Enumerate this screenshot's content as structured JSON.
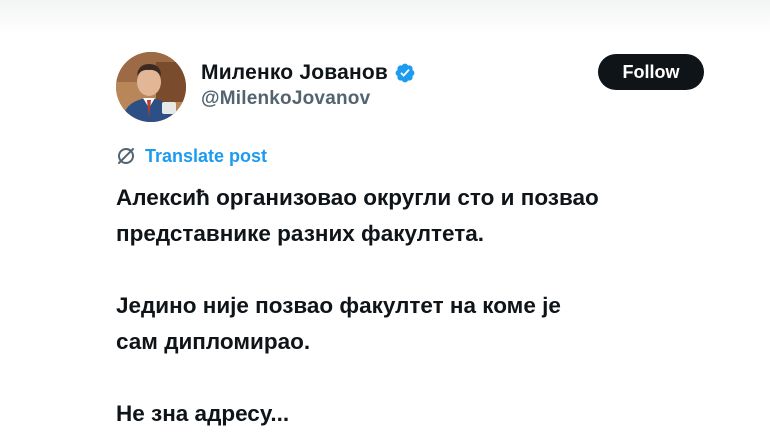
{
  "author": {
    "display_name": "Миленко Јованов",
    "handle": "@MilenkoJovanov",
    "verified_icon": "verified-badge-icon",
    "avatar": "avatar-photo"
  },
  "actions": {
    "follow_label": "Follow"
  },
  "translate": {
    "icon": "translate-icon",
    "label": "Translate post"
  },
  "post": {
    "paragraphs": [
      {
        "lines": [
          "Алексић организовао округли сто и позвао",
          "представнике разних факултета."
        ]
      },
      {
        "lines": [
          "Једино није позвао факултет на коме је",
          "сам дипломирао."
        ]
      },
      {
        "lines": [
          "Не зна адресу..."
        ]
      }
    ]
  },
  "colors": {
    "text_primary": "#0f1419",
    "text_secondary": "#536471",
    "link_blue": "#1d9bf0",
    "verified_blue": "#1d9bf0",
    "follow_bg": "#0f1419"
  }
}
